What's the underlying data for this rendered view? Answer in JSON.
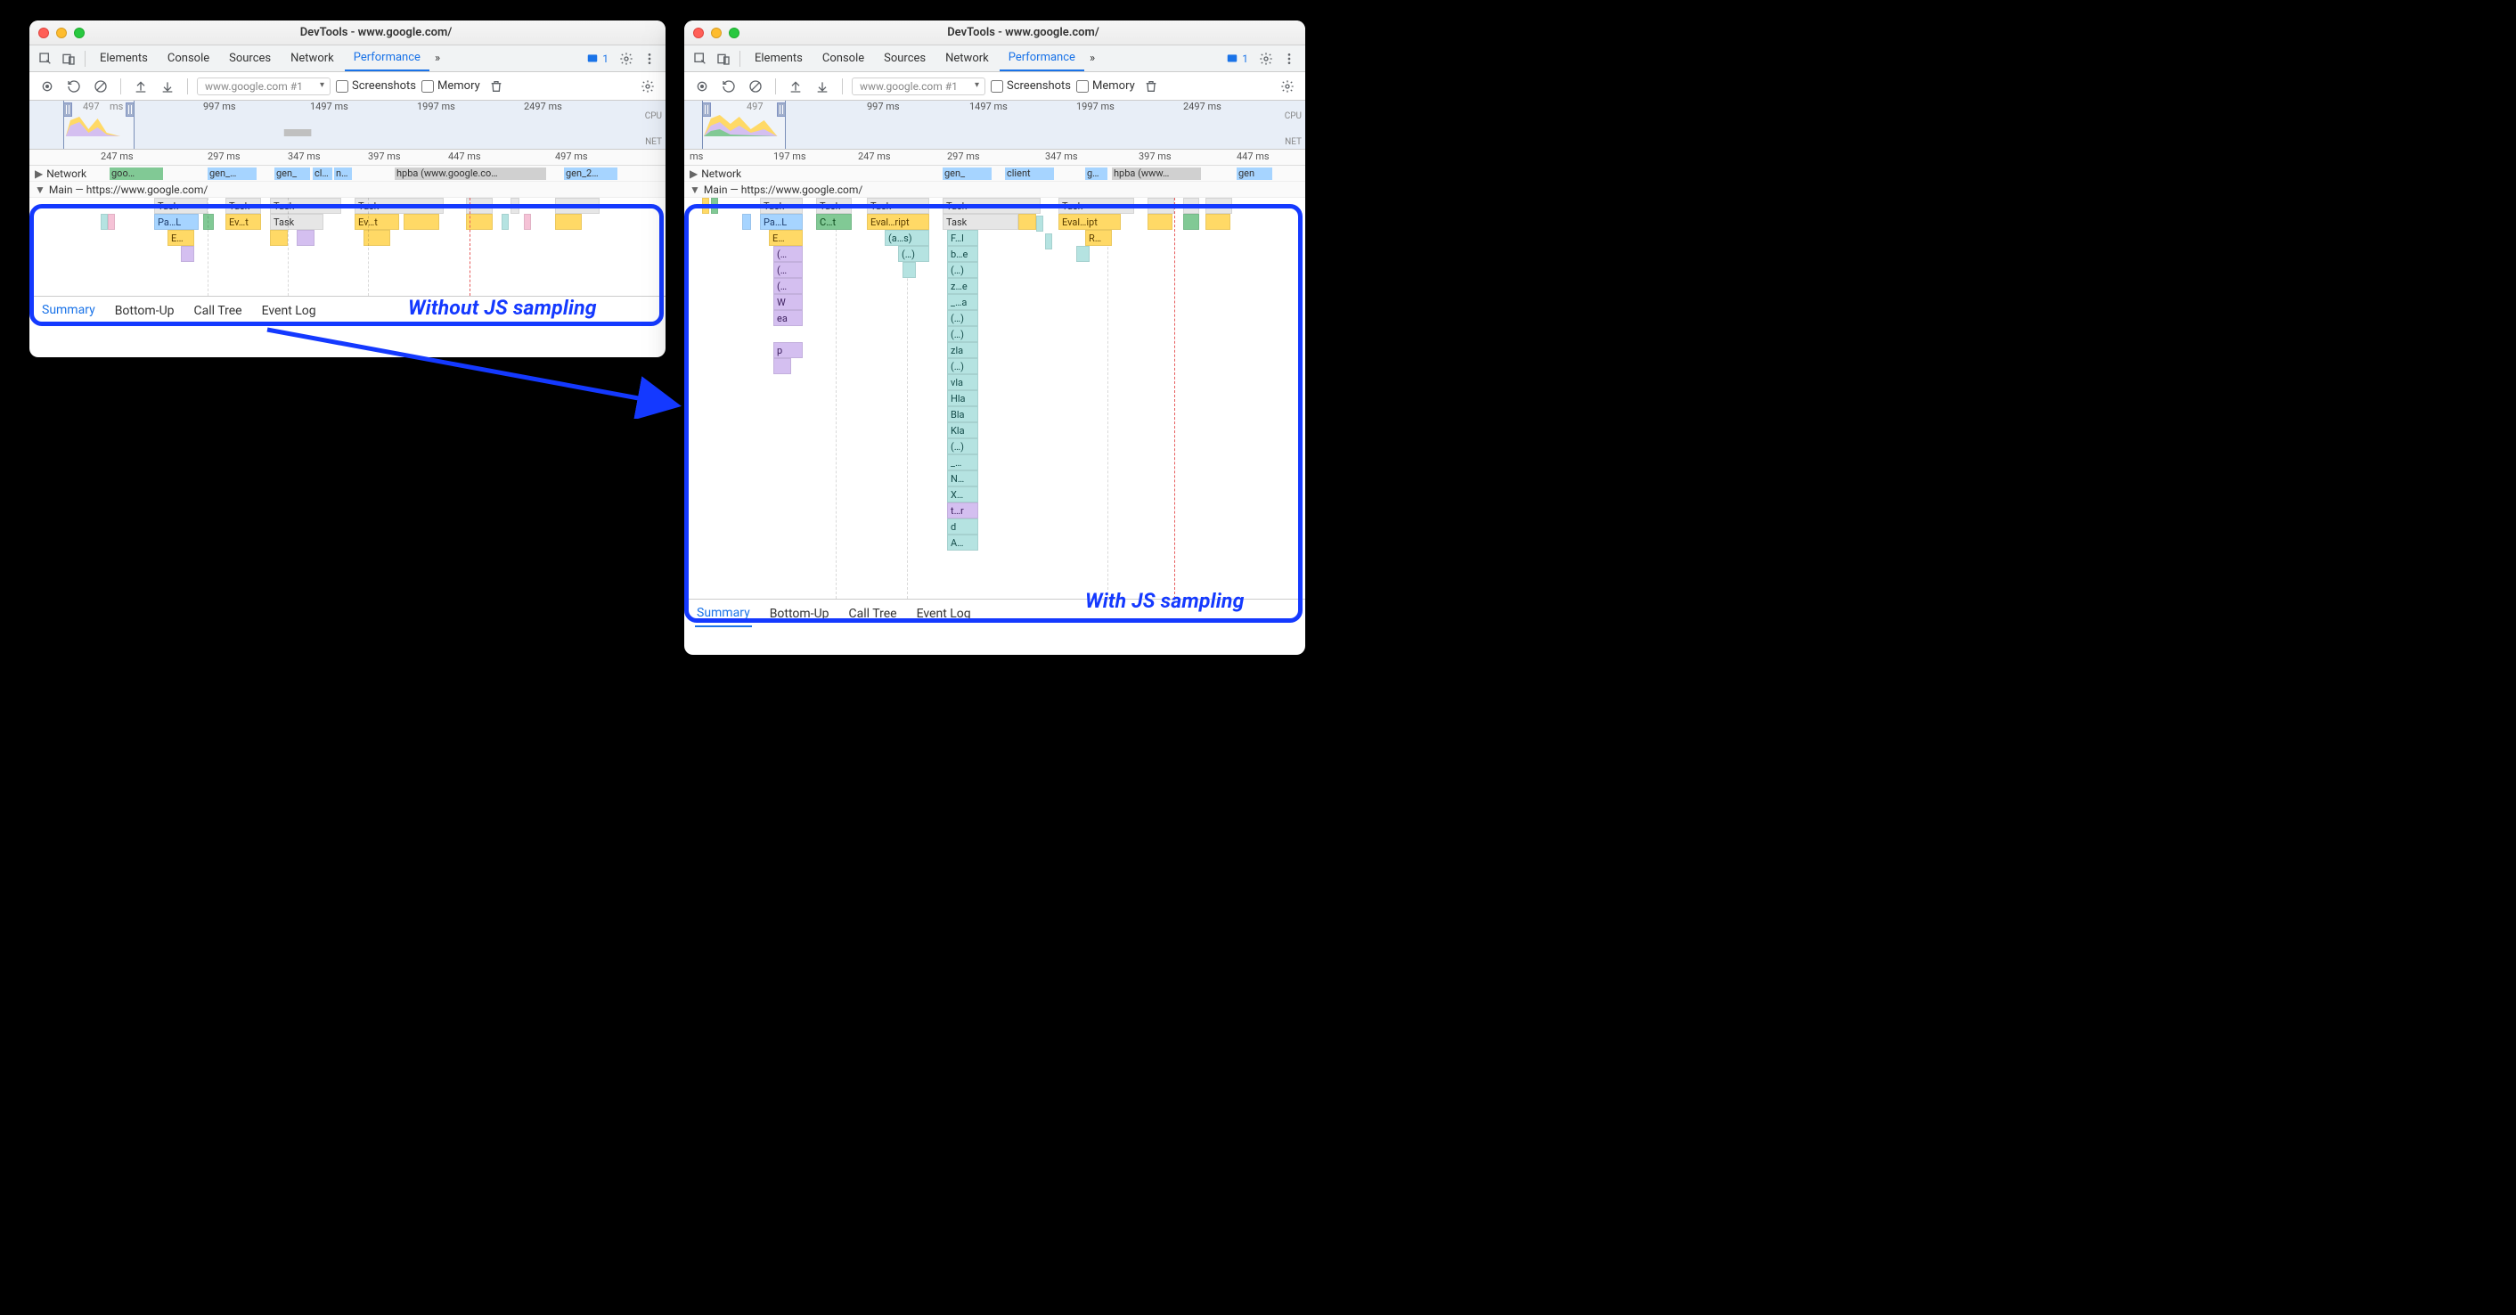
{
  "title": "DevTools - www.google.com/",
  "tabs": [
    "Elements",
    "Console",
    "Sources",
    "Network",
    "Performance"
  ],
  "active_tab": "Performance",
  "overflow_glyph": "»",
  "issues_count": "1",
  "toolbar": {
    "record_dropdown": "www.google.com #1",
    "screenshots_label": "Screenshots",
    "memory_label": "Memory"
  },
  "overview": {
    "cpu": "CPU",
    "net": "NET",
    "ticks": [
      "497 ms",
      "997 ms",
      "1497 ms",
      "1997 ms",
      "2497 ms"
    ],
    "handle_value": "497"
  },
  "left": {
    "ruler": [
      "247 ms",
      "297 ms",
      "347 ms",
      "397 ms",
      "447 ms",
      "497 ms"
    ],
    "network_label": "Network",
    "network_items": [
      "goo…",
      "gen_…",
      "gen_",
      "cl…",
      "n…",
      "hpba (www.google.co…",
      "gen_2…"
    ],
    "main_label": "Main — https://www.google.com/",
    "tasks": {
      "row1": [
        "Task",
        "Task",
        "Task",
        "Task"
      ],
      "row2": [
        "Pa…L",
        "Ev…t",
        "Task",
        "Ev…t"
      ],
      "row3": [
        "E…"
      ]
    },
    "highlight": "Without JS sampling"
  },
  "right": {
    "ruler": [
      "197 ms",
      "247 ms",
      "297 ms",
      "347 ms",
      "397 ms",
      "447 ms"
    ],
    "ruler_prefix": "ms",
    "network_label": "Network",
    "network_items": [
      "gen_",
      "client",
      "g…",
      "hpba (www…",
      "gen"
    ],
    "main_label": "Main — https://www.google.com/",
    "cols": [
      {
        "task": "Task",
        "items": [
          "Pa…L",
          "E…",
          "(…",
          "(…",
          "(…",
          "W",
          "ea",
          "",
          "p"
        ]
      },
      {
        "task": "Task",
        "items": [
          "C…t"
        ]
      },
      {
        "task": "Task",
        "items": [
          "Eval…ript",
          "(a…s)",
          "(…)"
        ]
      },
      {
        "task": "Task",
        "items": [
          "Task",
          "F…l",
          "b…e",
          "(…)",
          "z…e",
          "_…a",
          "(…)",
          "(…)",
          "zla",
          "(…)",
          "vla",
          "Hla",
          "Bla",
          "Kla",
          "(…)",
          "_…",
          "N…",
          "X…",
          "t…r",
          "d",
          "A…"
        ]
      },
      {
        "task": "Task",
        "items": [
          "Eval…ipt",
          "R…"
        ]
      }
    ],
    "highlight": "With JS sampling"
  },
  "details_tabs": [
    "Summary",
    "Bottom-Up",
    "Call Tree",
    "Event Log"
  ],
  "details_active": "Summary"
}
